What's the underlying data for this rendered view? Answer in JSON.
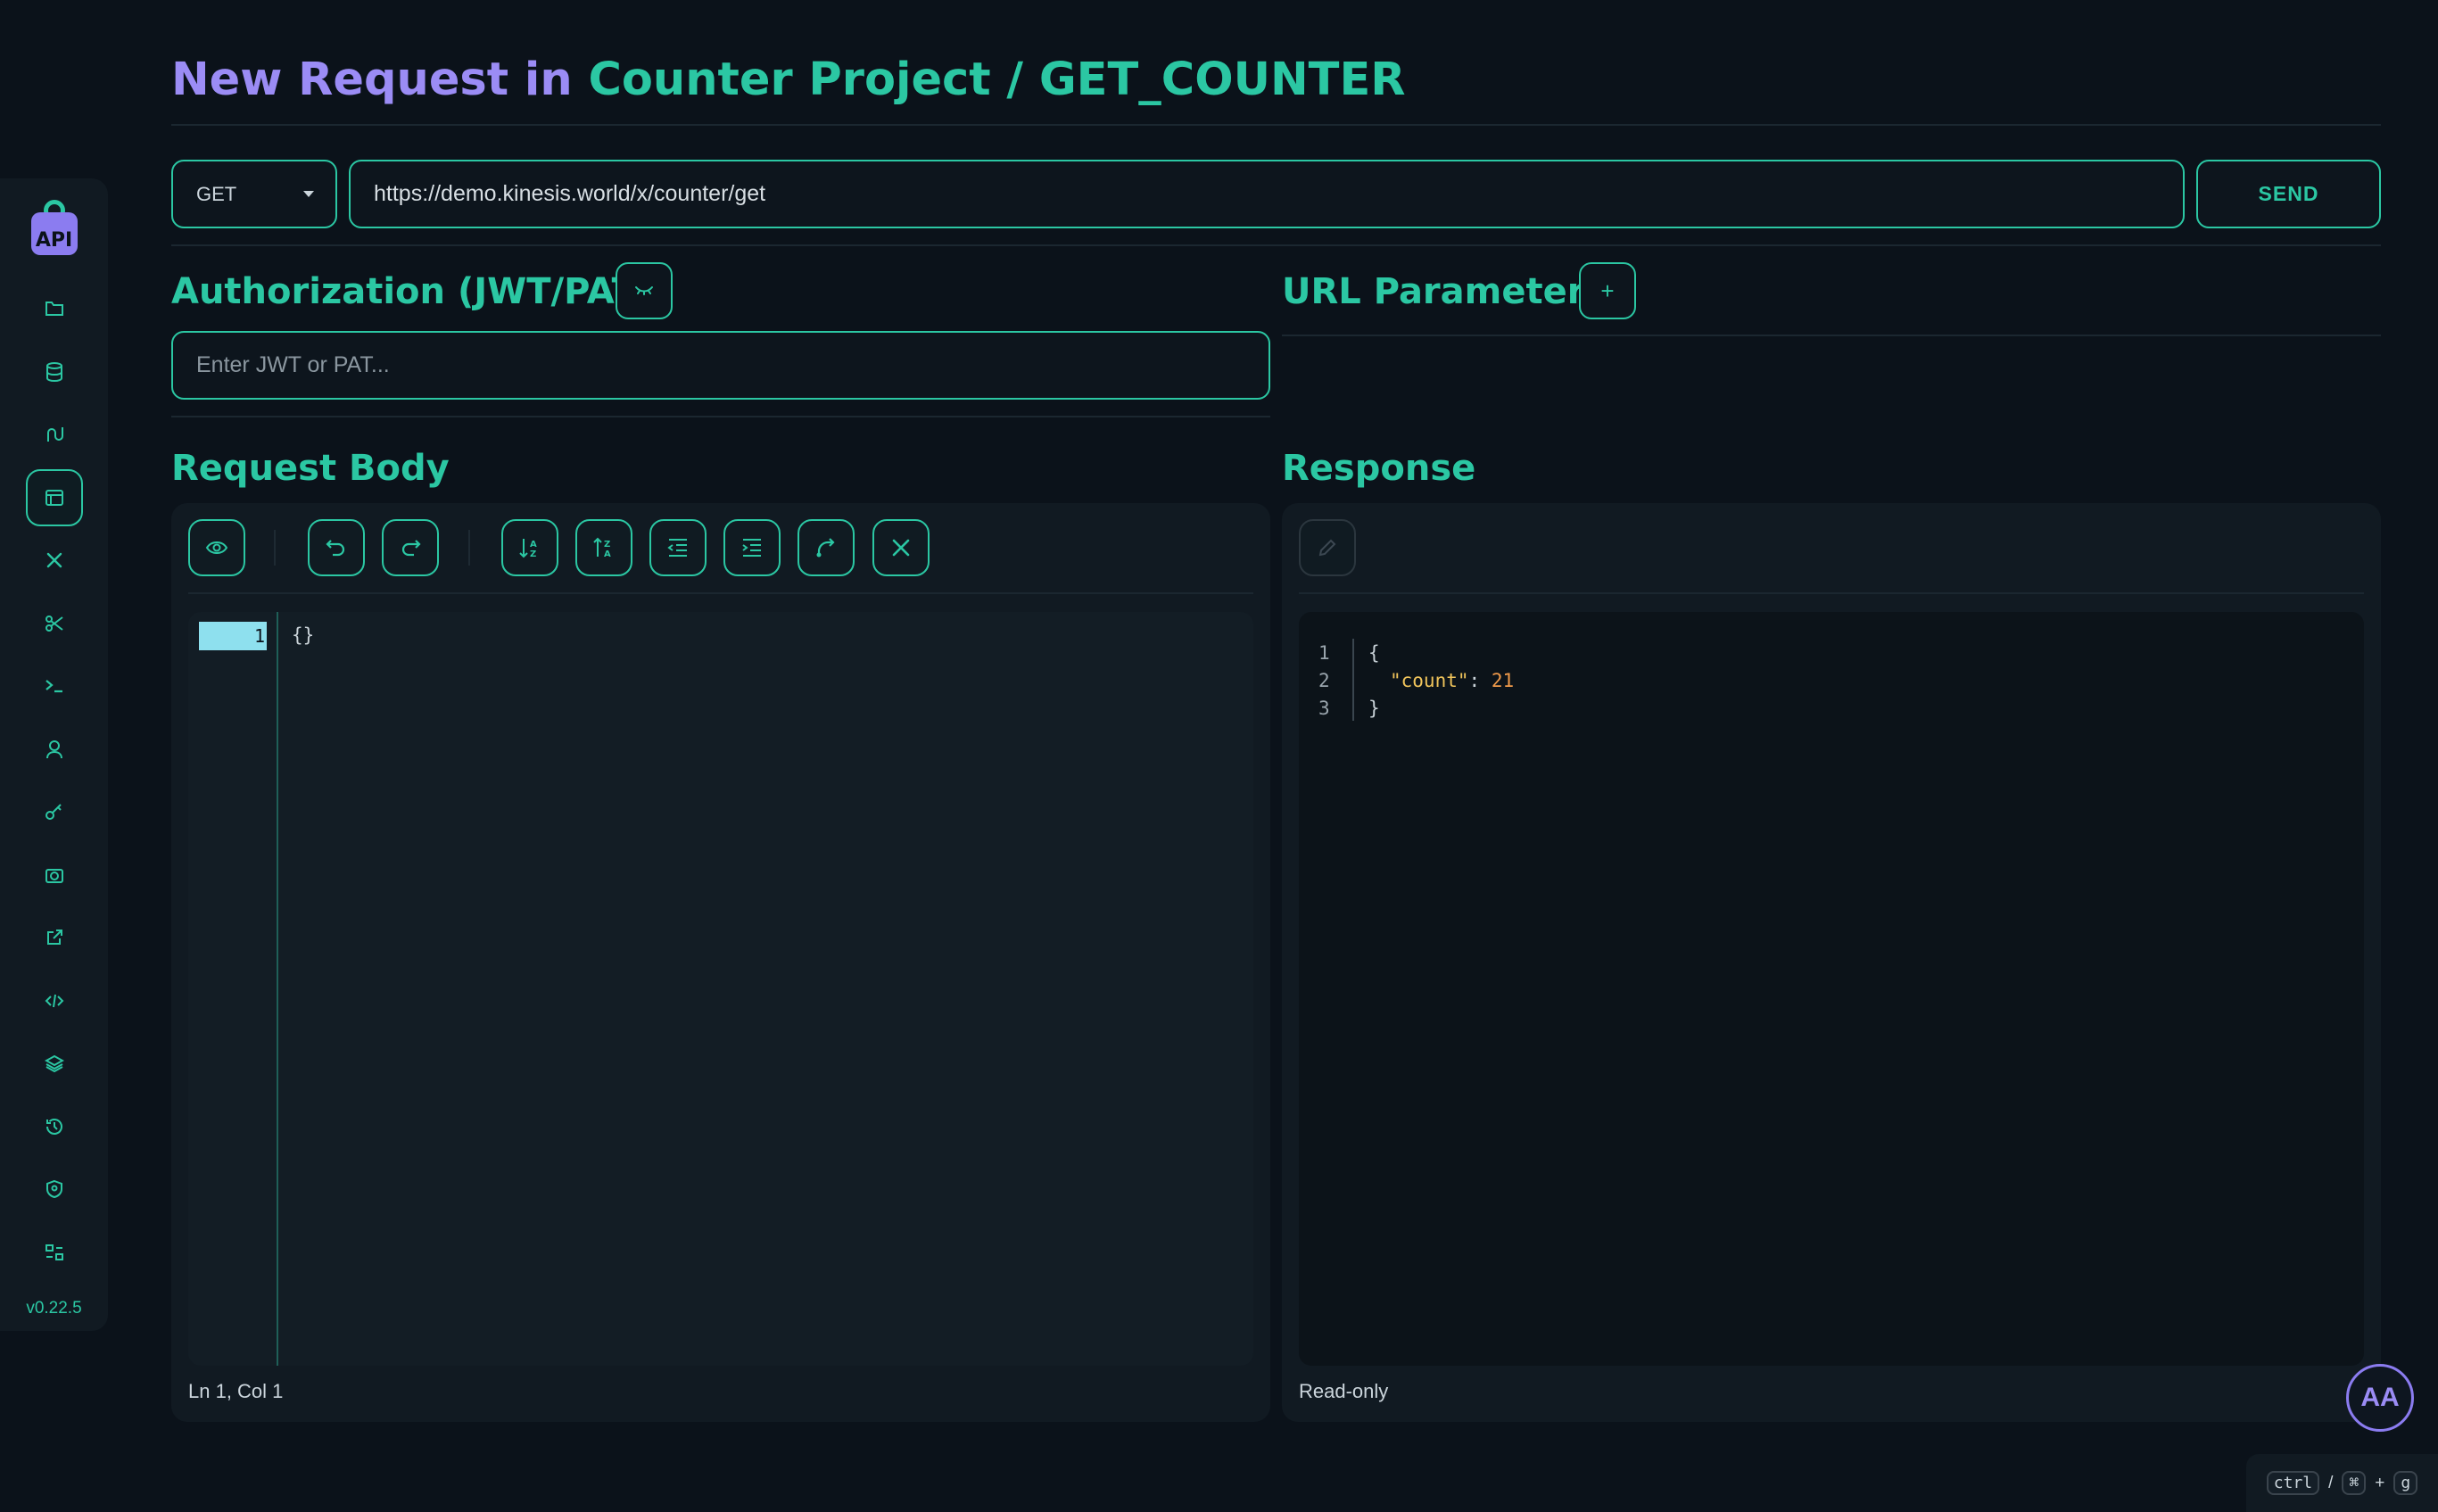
{
  "header": {
    "title_prefix": "New Request in ",
    "project": "Counter Project",
    "separator": " / ",
    "request_name": "GET_COUNTER"
  },
  "request": {
    "method": "GET",
    "url": "https://demo.kinesis.world/x/counter/get",
    "send_label": "SEND"
  },
  "authorization": {
    "title": "Authorization (JWT/PAT)",
    "placeholder": "Enter JWT or PAT..."
  },
  "url_parameters": {
    "title": "URL Parameters",
    "add_label": "+"
  },
  "request_body": {
    "title": "Request Body",
    "line_number": "1",
    "code": "{}",
    "status": "Ln 1, Col 1"
  },
  "response": {
    "title": "Response",
    "lines": [
      {
        "n": "1",
        "text": "{"
      },
      {
        "n": "2",
        "key": "\"count\"",
        "colon": ": ",
        "value": "21"
      },
      {
        "n": "3",
        "text": "}"
      }
    ],
    "status": "Read-only"
  },
  "sidebar": {
    "version": "v0.22.5",
    "logo_text": "API",
    "icons": [
      "folder-icon",
      "database-icon",
      "route-icon",
      "window-icon",
      "tools-icon",
      "scissors-icon",
      "terminal-icon",
      "user-icon",
      "key-icon",
      "camera-icon",
      "external-link-icon",
      "code-icon",
      "layers-icon",
      "history-icon",
      "shield-user-icon",
      "grid-settings-icon"
    ]
  },
  "theme_button": {
    "label": "AA"
  },
  "shortcut": {
    "key1": "ctrl",
    "sep": "/",
    "key2": "⌘",
    "plus": "+",
    "key3": "g"
  },
  "colors": {
    "accent": "#2bc7a3",
    "purple": "#9b8cf5",
    "background": "#0b121a"
  }
}
